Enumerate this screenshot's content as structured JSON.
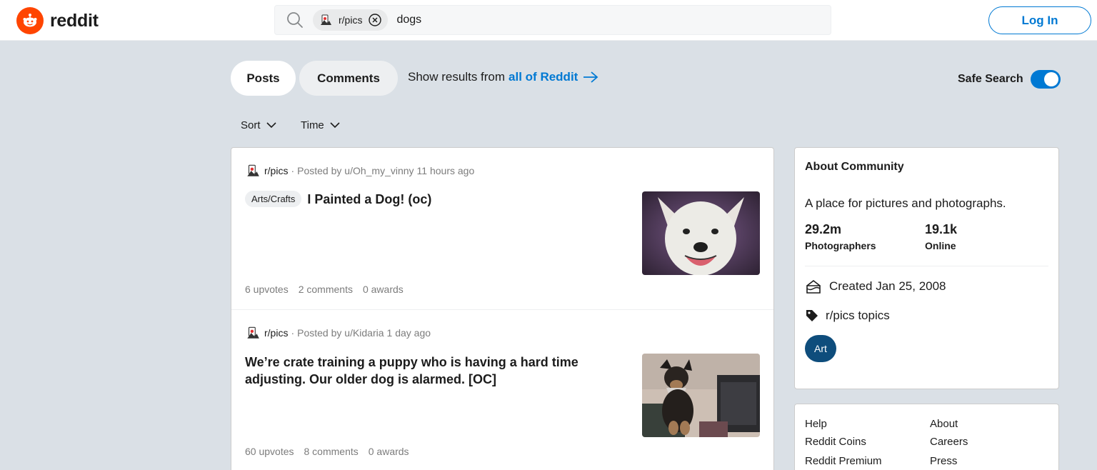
{
  "header": {
    "logo_text": "reddit",
    "search": {
      "chip_label": "r/pics",
      "query": "dogs"
    },
    "login_label": "Log In"
  },
  "tabs": [
    {
      "label": "Posts",
      "active": true
    },
    {
      "label": "Comments",
      "active": false
    }
  ],
  "show_results": {
    "prefix": "Show results from",
    "link": "all of Reddit"
  },
  "safe_search": {
    "label": "Safe Search",
    "enabled": true
  },
  "sort": [
    {
      "label": "Sort"
    },
    {
      "label": "Time"
    }
  ],
  "posts": [
    {
      "subreddit": "r/pics",
      "posted_by": "Posted by u/Oh_my_vinny",
      "age": "11 hours ago",
      "flair": "Arts/Crafts",
      "title": "I Painted a Dog! (oc)",
      "upvotes": "6 upvotes",
      "comments": "2 comments",
      "awards": "0 awards"
    },
    {
      "subreddit": "r/pics",
      "posted_by": "Posted by u/Kidaria",
      "age": "1 day ago",
      "title": "We’re crate training a puppy who is having a hard time adjusting. Our older dog is alarmed. [OC]",
      "upvotes": "60 upvotes",
      "comments": "8 comments",
      "awards": "0 awards"
    }
  ],
  "about": {
    "title": "About Community",
    "description": "A place for pictures and photographs.",
    "members_value": "29.2m",
    "members_label": "Photographers",
    "online_value": "19.1k",
    "online_label": "Online",
    "created": "Created Jan 25, 2008",
    "topics_label": "r/pics topics",
    "topic_chip": "Art"
  },
  "footer": {
    "col1": [
      "Help",
      "Reddit Coins",
      "Reddit Premium"
    ],
    "col2": [
      "About",
      "Careers",
      "Press"
    ]
  },
  "colors": {
    "brand": "#ff4500",
    "accent": "#0079d3",
    "background": "#dae0e6",
    "topic_chip": "#0e4d7c"
  }
}
